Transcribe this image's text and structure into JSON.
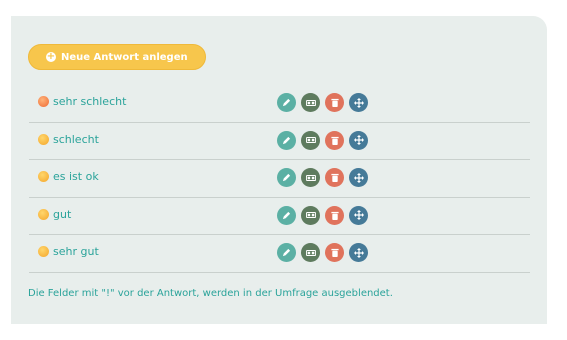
{
  "toolbar": {
    "add_label": "Neue Antwort anlegen",
    "add_icon": "plus-circle-icon"
  },
  "answers": [
    {
      "label": "sehr schlecht",
      "emoji": "angry-face"
    },
    {
      "label": "schlecht",
      "emoji": "disappointed-face"
    },
    {
      "label": "es ist ok",
      "emoji": "neutral-face"
    },
    {
      "label": "gut",
      "emoji": "slight-smile-face"
    },
    {
      "label": "sehr gut",
      "emoji": "smiling-face"
    }
  ],
  "actions": [
    {
      "name": "edit",
      "icon": "pencil-icon",
      "color": "#5bb0a4"
    },
    {
      "name": "toggle",
      "icon": "toggle-icon",
      "color": "#5e7b5e"
    },
    {
      "name": "delete",
      "icon": "trash-icon",
      "color": "#e0735c"
    },
    {
      "name": "move",
      "icon": "move-arrows-icon",
      "color": "#457a98"
    }
  ],
  "footer_note": "Die Felder mit \"!\" vor der Antwort, werden in der Umfrage ausgeblendet.",
  "colors": {
    "accent": "#2aa39a",
    "button_yellow": "#f7c64c",
    "panel_bg": "#e8eeec"
  }
}
